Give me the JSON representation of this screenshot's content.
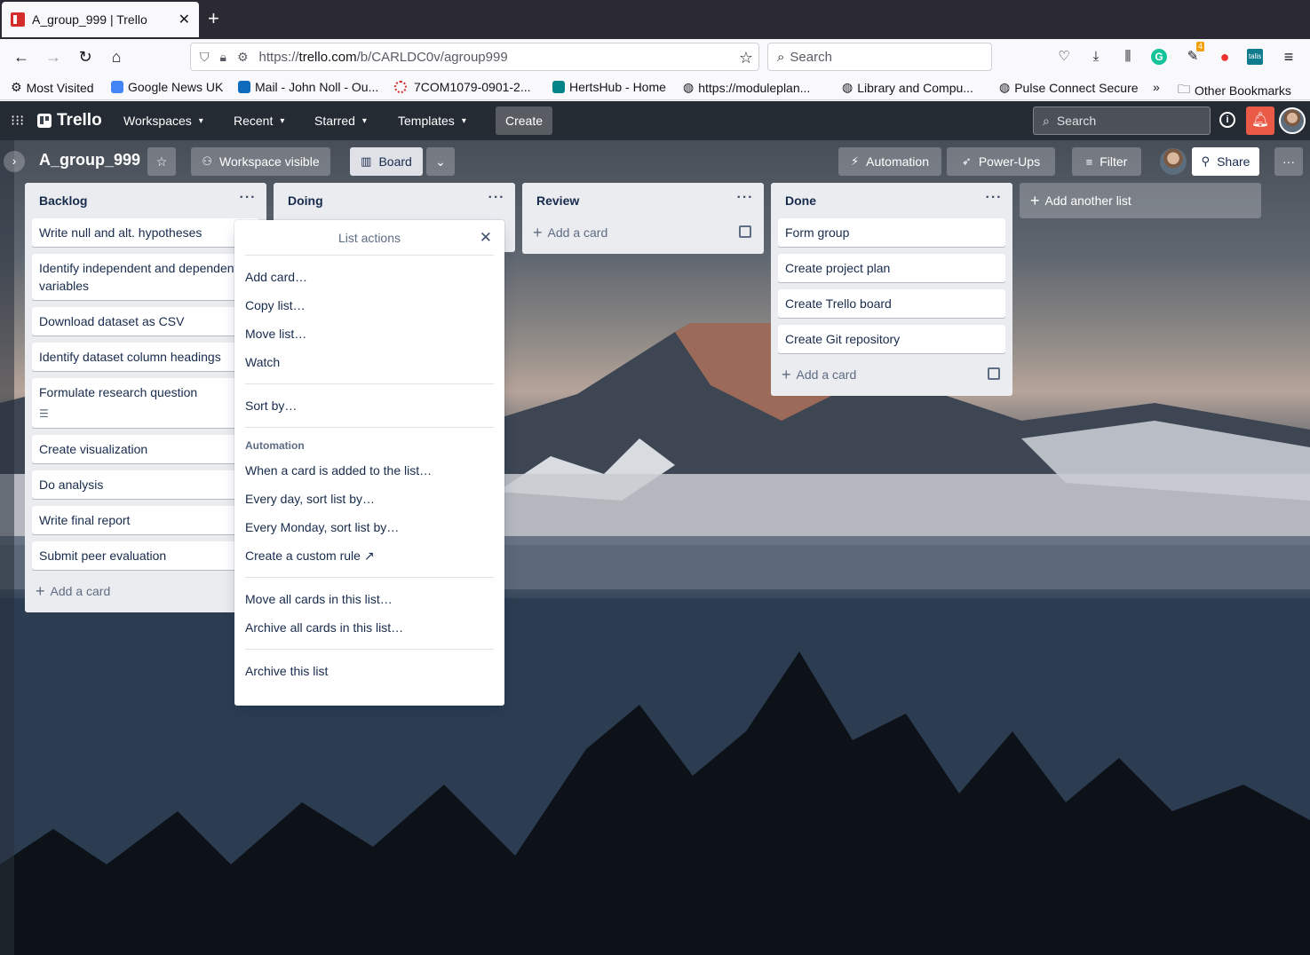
{
  "browser": {
    "tab_title": "A_group_999 | Trello",
    "url_prefix": "https://",
    "url_host": "trello.com",
    "url_path": "/b/CARLDC0v/agroup999",
    "search_placeholder": "Search",
    "bookmarks": [
      {
        "label": "Most Visited",
        "icon": "gear-icon"
      },
      {
        "label": "Google News UK",
        "icon": "google-news-icon"
      },
      {
        "label": "Mail - John Noll - Ou...",
        "icon": "outlook-icon"
      },
      {
        "label": "7COM1079-0901-2...",
        "icon": "dotted-circle-icon"
      },
      {
        "label": "HertsHub - Home",
        "icon": "sharepoint-icon"
      },
      {
        "label": "https://moduleplan...",
        "icon": "globe-icon"
      },
      {
        "label": "Library and Compu...",
        "icon": "globe-icon"
      },
      {
        "label": "Pulse Connect Secure",
        "icon": "globe-icon"
      },
      {
        "label": "Other Bookmarks",
        "icon": "folder-icon"
      }
    ],
    "badge_count": "4"
  },
  "header": {
    "logo": "Trello",
    "menus": [
      "Workspaces",
      "Recent",
      "Starred",
      "Templates"
    ],
    "create_label": "Create",
    "search_placeholder": "Search"
  },
  "board": {
    "title": "A_group_999",
    "visibility_label": "Workspace visible",
    "view_label": "Board",
    "automation_label": "Automation",
    "powerups_label": "Power-Ups",
    "filter_label": "Filter",
    "share_label": "Share",
    "add_list_label": "Add another list",
    "add_card_label": "Add a card"
  },
  "lists": [
    {
      "title": "Backlog",
      "cards": [
        "Write null and alt. hypotheses",
        "Identify independent and dependent variables",
        "Download dataset as CSV",
        "Identify dataset column headings",
        "Formulate research question",
        "Create visualization",
        "Do analysis",
        "Write final report",
        "Submit peer evaluation"
      ]
    },
    {
      "title": "Doing",
      "cards": []
    },
    {
      "title": "Review",
      "cards": []
    },
    {
      "title": "Done",
      "cards": [
        "Form group",
        "Create project plan",
        "Create Trello board",
        "Create Git repository"
      ]
    }
  ],
  "popover": {
    "title": "List actions",
    "group1": [
      "Add card…",
      "Copy list…",
      "Move list…",
      "Watch"
    ],
    "group2": [
      "Sort by…"
    ],
    "automation_heading": "Automation",
    "group3": [
      "When a card is added to the list…",
      "Every day, sort list by…",
      "Every Monday, sort list by…",
      "Create a custom rule ↗"
    ],
    "group4": [
      "Move all cards in this list…",
      "Archive all cards in this list…"
    ],
    "group5": [
      "Archive this list"
    ]
  },
  "colors": {
    "header_bg": "#1e242c",
    "list_bg": "#ebecf0",
    "notification": "#eb5a46",
    "text": "#172b4d"
  }
}
